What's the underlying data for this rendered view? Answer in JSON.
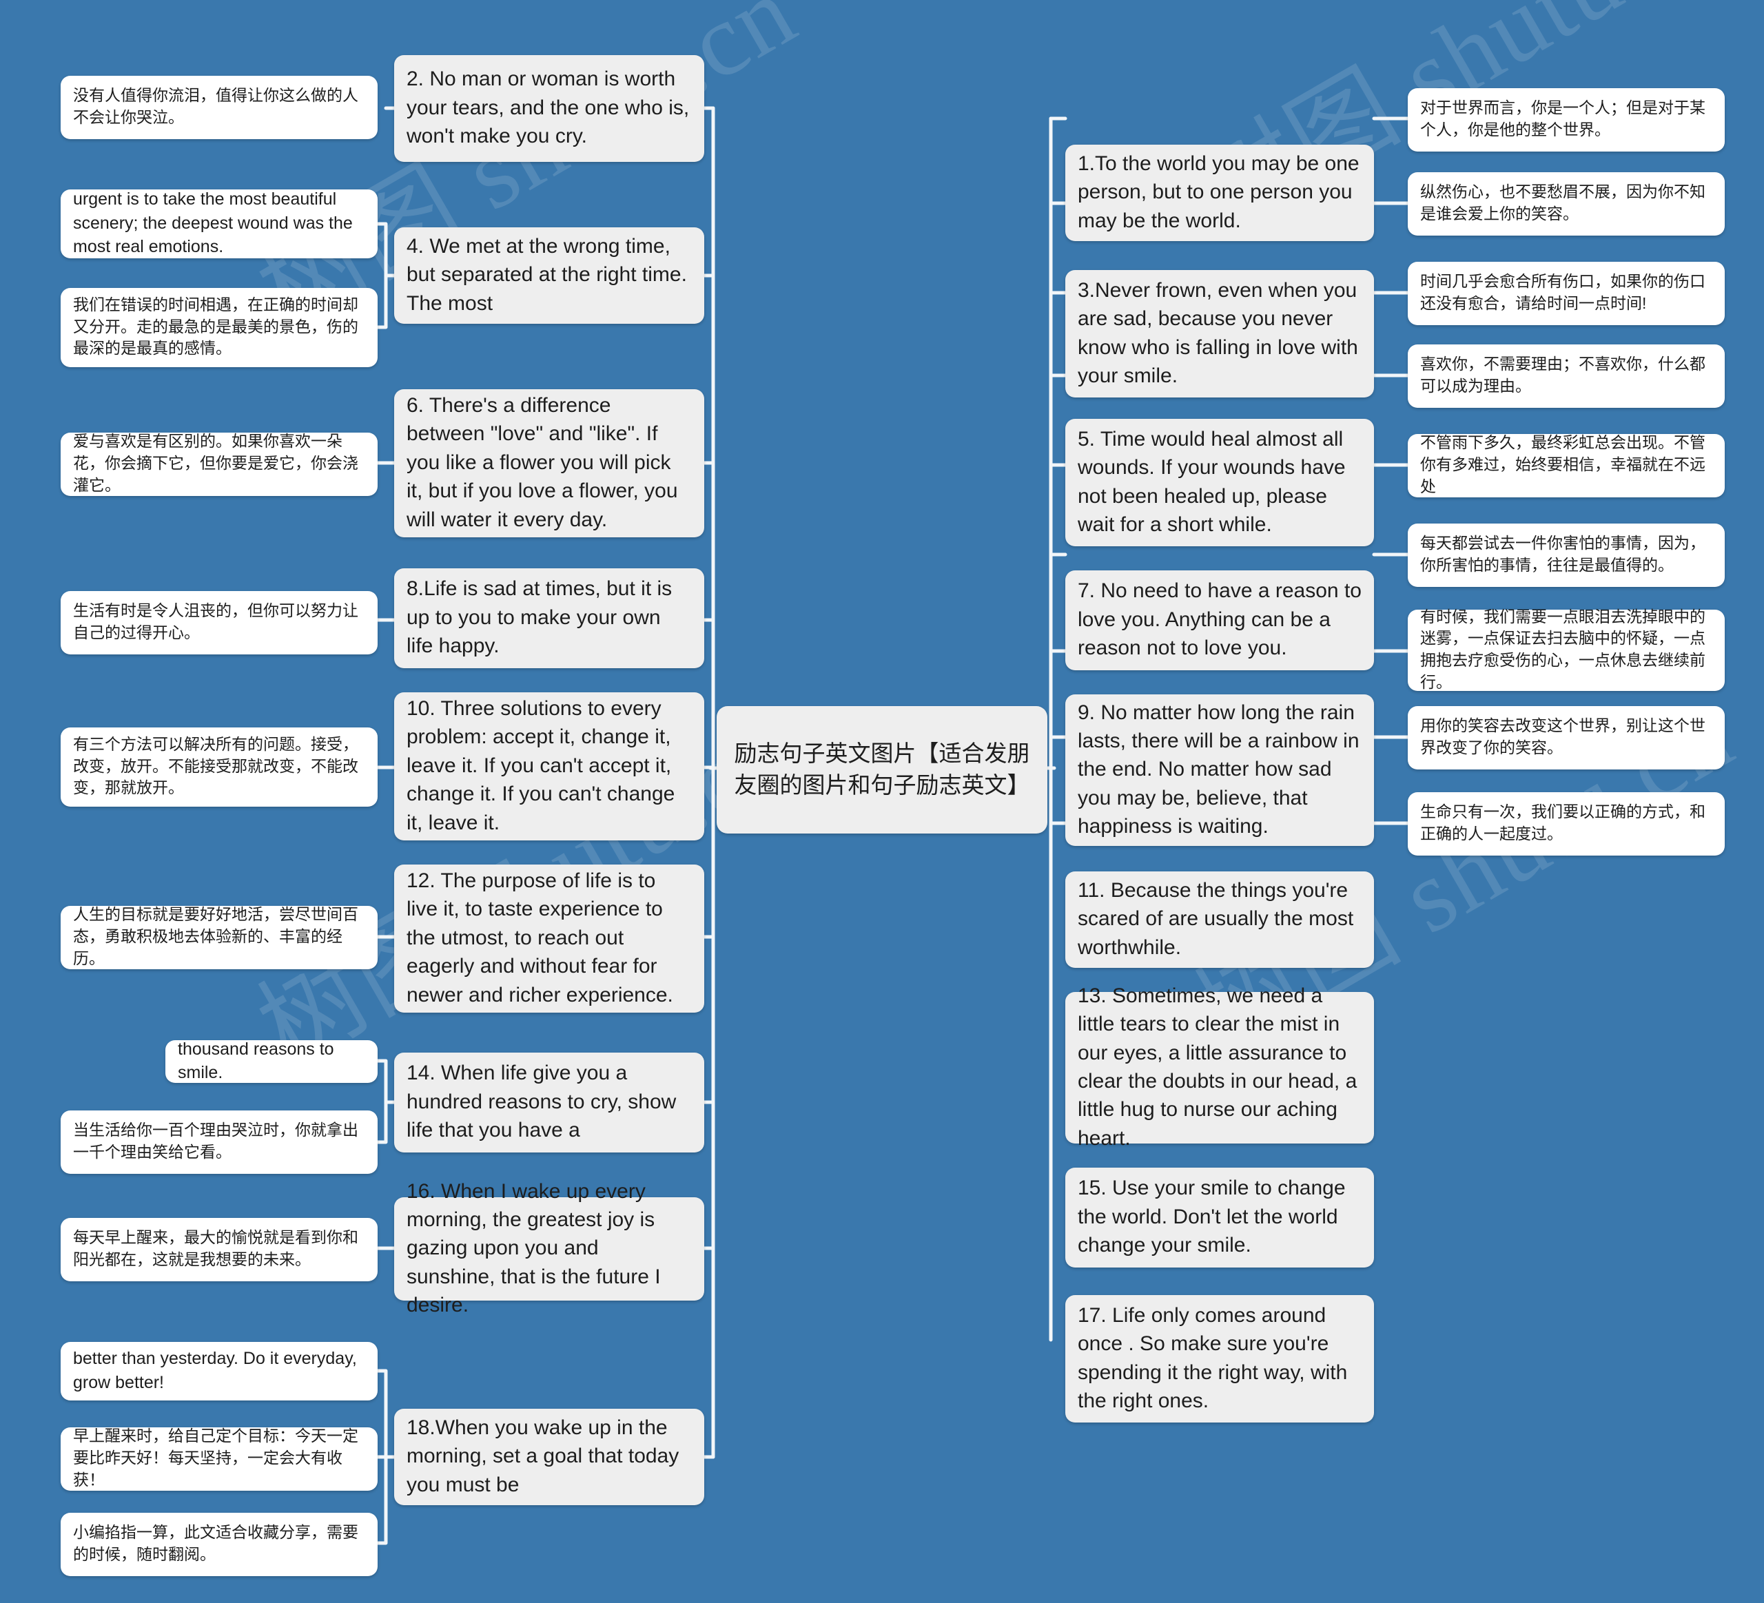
{
  "theme": {
    "background": "#3a78ad",
    "branch_fill": "#eeeeee",
    "leaf_fill": "#ffffff",
    "line_color": "#f2f6f9",
    "text_color": "#1d1d1d"
  },
  "watermarks": [
    "树图 shutu.cn",
    "树图 shutu.cn",
    "树图 shutu.cn",
    "树图 shutu.cn"
  ],
  "root": {
    "title": "励志句子英文图片【适合发朋友圈的图片和句子励志英文】"
  },
  "left_branches": [
    {
      "id": "b2",
      "text": "2. No man or woman is worth your tears, and the one who is, won't make you cry.",
      "children": [
        {
          "text": "没有人值得你流泪，值得让你这么做的人不会让你哭泣。",
          "lang": "cn"
        }
      ]
    },
    {
      "id": "b4",
      "text": "4. We met at the wrong time, but separated at the right time. The most",
      "children": [
        {
          "text": "urgent is to take the most beautiful scenery; the deepest wound was the most real emotions.",
          "lang": "en"
        },
        {
          "text": "我们在错误的时间相遇，在正确的时间却又分开。走的最急的是最美的景色，伤的最深的是最真的感情。",
          "lang": "cn"
        }
      ]
    },
    {
      "id": "b6",
      "text": "6. There's a difference between \"love\" and \"like\". If you like a flower you will pick it, but if you love a flower, you will water it every day.",
      "children": [
        {
          "text": "爱与喜欢是有区别的。如果你喜欢一朵花，你会摘下它，但你要是爱它，你会浇灌它。",
          "lang": "cn"
        }
      ]
    },
    {
      "id": "b8",
      "text": "8.Life is sad at times, but it is up to you to make your own life happy.",
      "children": [
        {
          "text": "生活有时是令人沮丧的，但你可以努力让自己的过得开心。",
          "lang": "cn"
        }
      ]
    },
    {
      "id": "b10",
      "text": "10. Three solutions to every problem: accept it, change it, leave it. If you can't accept it, change it. If you can't change it, leave it.",
      "children": [
        {
          "text": "有三个方法可以解决所有的问题。接受，改变，放开。不能接受那就改变，不能改变，那就放开。",
          "lang": "cn"
        }
      ]
    },
    {
      "id": "b12",
      "text": "12. The purpose of life is to live it, to taste experience to the utmost, to reach out eagerly and without fear for newer and richer experience.",
      "children": [
        {
          "text": "人生的目标就是要好好地活，尝尽世间百态，勇敢积极地去体验新的、丰富的经历。",
          "lang": "cn"
        }
      ]
    },
    {
      "id": "b14",
      "text": "14. When life give you a hundred reasons to cry, show life that you have a",
      "children": [
        {
          "text": "thousand reasons to smile.",
          "lang": "en"
        },
        {
          "text": "当生活给你一百个理由哭泣时，你就拿出一千个理由笑给它看。",
          "lang": "cn"
        }
      ]
    },
    {
      "id": "b16",
      "text": "16. When I wake up every morning, the greatest joy is gazing upon you and sunshine, that is the future I desire.",
      "children": [
        {
          "text": "每天早上醒来，最大的愉悦就是看到你和阳光都在，这就是我想要的未来。",
          "lang": "cn"
        }
      ]
    },
    {
      "id": "b18",
      "text": "18.When you wake up in the morning, set a goal that today you must be",
      "children": [
        {
          "text": "better than yesterday. Do it everyday, grow better!",
          "lang": "en"
        },
        {
          "text": "早上醒来时，给自己定个目标：今天一定要比昨天好！每天坚持，一定会大有收获！",
          "lang": "cn"
        },
        {
          "text": "小编掐指一算，此文适合收藏分享，需要的时候，随时翻阅。",
          "lang": "cn"
        }
      ]
    }
  ],
  "right_branches": [
    {
      "id": "b1",
      "text": "1.To the world you may be one person, but to one person you may be the world.",
      "children": [
        {
          "text": "对于世界而言，你是一个人；但是对于某个人，你是他的整个世界。",
          "lang": "cn"
        }
      ]
    },
    {
      "id": "b3",
      "text": "3.Never frown, even when you are sad, because you never know who is falling in love with your smile.",
      "children": [
        {
          "text": "纵然伤心，也不要愁眉不展，因为你不知是谁会爱上你的笑容。",
          "lang": "cn"
        }
      ]
    },
    {
      "id": "b5",
      "text": "5. Time would heal almost all wounds. If your wounds have not been healed up, please wait for a short while.",
      "children": [
        {
          "text": "时间几乎会愈合所有伤口，如果你的伤口还没有愈合，请给时间一点时间!",
          "lang": "cn"
        }
      ]
    },
    {
      "id": "b7",
      "text": "7. No need to have a reason to love you. Anything can be a reason not to love you.",
      "children": [
        {
          "text": "喜欢你，不需要理由；不喜欢你，什么都可以成为理由。",
          "lang": "cn"
        }
      ]
    },
    {
      "id": "b9",
      "text": "9. No matter how long the rain lasts, there will be a rainbow in the end. No matter how sad you may be, believe, that happiness is waiting.",
      "children": [
        {
          "text": "不管雨下多久，最终彩虹总会出现。不管你有多难过，始终要相信，幸福就在不远处",
          "lang": "cn"
        }
      ]
    },
    {
      "id": "b11",
      "text": "11. Because the things you're scared of are usually the most worthwhile.",
      "children": [
        {
          "text": "每天都尝试去一件你害怕的事情，因为，你所害怕的事情，往往是最值得的。",
          "lang": "cn"
        }
      ]
    },
    {
      "id": "b13",
      "text": "13. Sometimes, we need a little tears to clear the mist in our eyes, a little assurance to clear the doubts in our head, a little hug to nurse our aching heart.",
      "children": [
        {
          "text": "有时候，我们需要一点眼泪去洗掉眼中的迷雾，一点保证去扫去脑中的怀疑，一点拥抱去疗愈受伤的心，一点休息去继续前行。",
          "lang": "cn"
        }
      ]
    },
    {
      "id": "b15",
      "text": "15. Use your smile to change the world. Don't let the world change your smile.",
      "children": [
        {
          "text": "用你的笑容去改变这个世界，别让这个世界改变了你的笑容。",
          "lang": "cn"
        }
      ]
    },
    {
      "id": "b17",
      "text": "17. Life only comes around once . So make sure you're spending it the right way, with the right ones.",
      "children": [
        {
          "text": "生命只有一次，我们要以正确的方式，和正确的人一起度过。",
          "lang": "cn"
        }
      ]
    }
  ]
}
